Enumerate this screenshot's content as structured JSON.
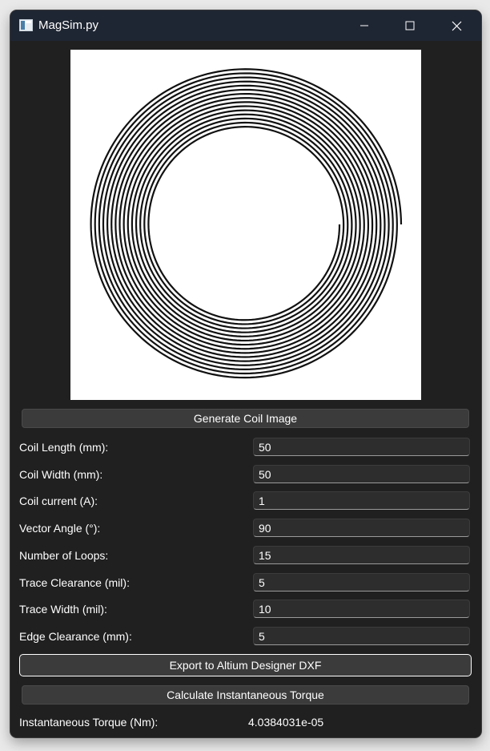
{
  "window": {
    "title": "MagSim.py",
    "icons": [
      "app-icon",
      "minimize-icon",
      "maximize-icon",
      "close-icon"
    ]
  },
  "coil_image": {
    "description_icon": "spiral-coil-image"
  },
  "buttons": {
    "generate": "Generate Coil Image",
    "export": "Export to Altium Designer DXF",
    "calculate": "Calculate Instantaneous Torque"
  },
  "params": [
    {
      "label": "Coil Length (mm):",
      "value": "50"
    },
    {
      "label": "Coil Width (mm):",
      "value": "50"
    },
    {
      "label": "Coil current (A):",
      "value": "1"
    },
    {
      "label": "Vector Angle (°):",
      "value": "90"
    },
    {
      "label": "Number of Loops:",
      "value": "15"
    },
    {
      "label": "Trace Clearance (mil):",
      "value": "5"
    },
    {
      "label": "Trace Width (mil):",
      "value": "10"
    },
    {
      "label": "Edge Clearance (mm):",
      "value": "5"
    }
  ],
  "result": {
    "label": "Instantaneous Torque (Nm):",
    "value": "4.0384031e-05"
  }
}
